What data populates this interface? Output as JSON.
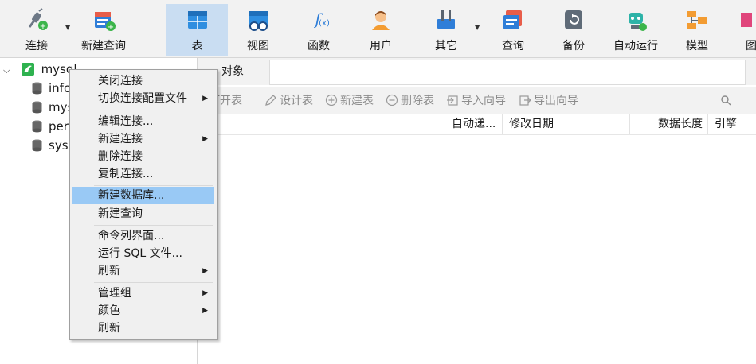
{
  "toolbar": {
    "buttons": [
      {
        "label": "连接"
      },
      {
        "label": "新建查询"
      },
      {
        "label": "表"
      },
      {
        "label": "视图"
      },
      {
        "label": "函数"
      },
      {
        "label": "用户"
      },
      {
        "label": "其它"
      },
      {
        "label": "查询"
      },
      {
        "label": "备份"
      },
      {
        "label": "自动运行"
      },
      {
        "label": "模型"
      },
      {
        "label": "图"
      }
    ],
    "active": "表",
    "accent": "#c9ddf2"
  },
  "tree": {
    "connection": "mysql",
    "databases": [
      "information_schema",
      "mysql",
      "performance_schema",
      "sys"
    ]
  },
  "right": {
    "tab_label": "对象",
    "tools": {
      "open_table": "打开表",
      "design_table": "设计表",
      "new_table": "新建表",
      "delete_table": "删除表",
      "import_wizard": "导入向导",
      "export_wizard": "导出向导"
    },
    "columns": {
      "auto_inc": "自动递...",
      "modified": "修改日期",
      "data_len": "数据长度",
      "engine": "引擎"
    }
  },
  "menu": {
    "highlight_color": "#99c9f5",
    "items": [
      {
        "label": "关闭连接"
      },
      {
        "label": "切换连接配置文件"
      },
      {
        "label": "编辑连接..."
      },
      {
        "label": "新建连接"
      },
      {
        "label": "删除连接"
      },
      {
        "label": "复制连接..."
      },
      {
        "label": "新建数据库..."
      },
      {
        "label": "新建查询"
      },
      {
        "label": "命令列界面..."
      },
      {
        "label": "运行 SQL 文件..."
      },
      {
        "label": "刷新"
      },
      {
        "label": "管理组"
      },
      {
        "label": "颜色"
      },
      {
        "label": "刷新"
      }
    ]
  }
}
